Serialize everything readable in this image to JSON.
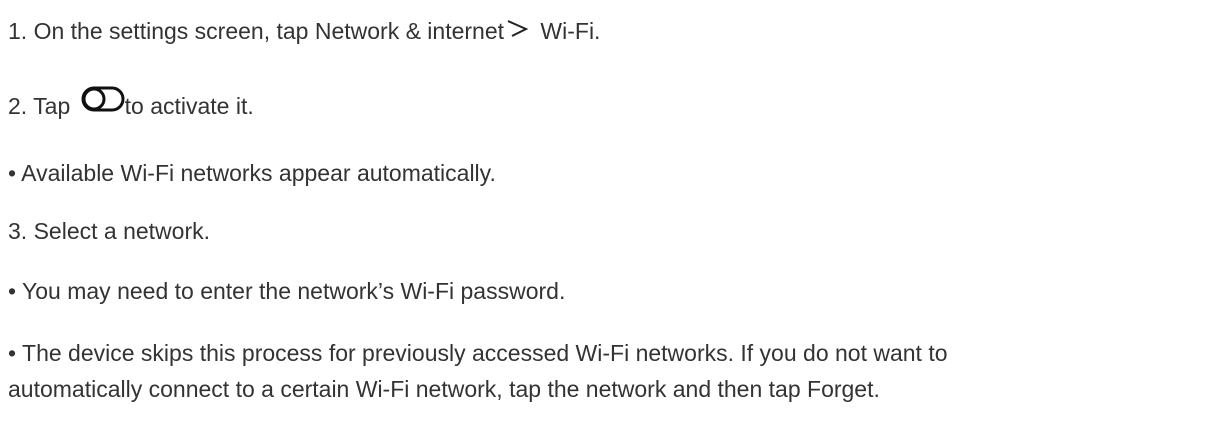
{
  "steps": [
    {
      "prefix": "1. On the settings screen, tap Network & internet",
      "icon": "chevron-right-icon",
      "suffix": " Wi-Fi."
    },
    {
      "prefix": "2. Tap ",
      "icon": "toggle-switch-icon",
      "suffix": "to activate it."
    }
  ],
  "bullet_available": "• Available Wi-Fi networks appear automatically.",
  "step3": "3. Select a network.",
  "bullet_password": "• You may need to enter the network’s Wi-Fi password.",
  "bullet_skip_line1": "• The device skips this process for previously accessed Wi-Fi networks. If you do not want to",
  "bullet_skip_line2": "automatically connect to a certain Wi-Fi network, tap the network and then tap Forget.",
  "colors": {
    "text": "#333333",
    "background": "#ffffff"
  }
}
